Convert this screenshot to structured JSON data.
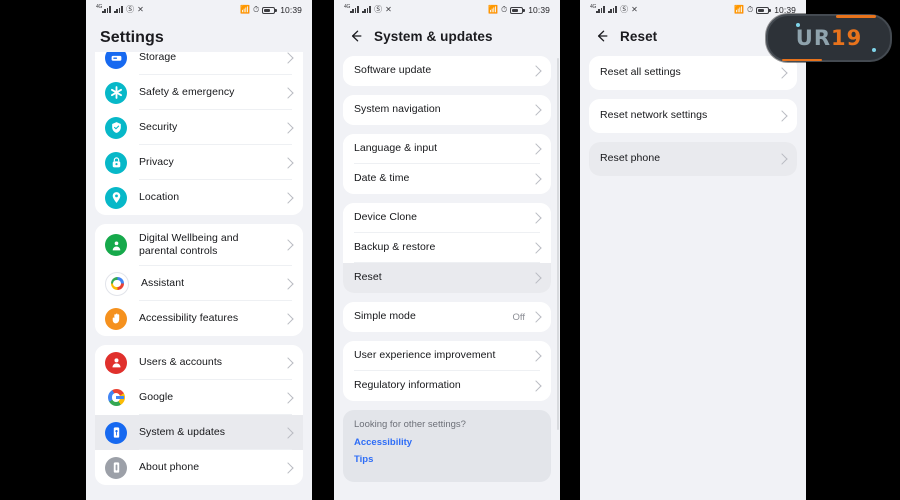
{
  "statusbar": {
    "time": "10:39",
    "left_icons": [
      "signal-4g-icon",
      "signal-bars-icon",
      "no-sim-icon",
      "silent-icon"
    ],
    "right_icons": [
      "vibrate-icon",
      "alarm-icon",
      "battery-icon"
    ],
    "signal_label": "4G"
  },
  "watermark": {
    "text_part_a": "UR",
    "text_part_b": "19"
  },
  "panels": {
    "settings": {
      "title": "Settings",
      "groups": [
        {
          "clipped_top": true,
          "rows": [
            {
              "label": "Storage",
              "icon": "storage-icon",
              "icon_class": "ic-storage",
              "selected": false
            },
            {
              "label": "Safety & emergency",
              "icon": "safety-emergency-icon",
              "icon_class": "ic-safety",
              "selected": false
            },
            {
              "label": "Security",
              "icon": "security-shield-icon",
              "icon_class": "ic-security",
              "selected": false
            },
            {
              "label": "Privacy",
              "icon": "privacy-lock-icon",
              "icon_class": "ic-privacy",
              "selected": false
            },
            {
              "label": "Location",
              "icon": "location-pin-icon",
              "icon_class": "ic-location",
              "selected": false
            }
          ]
        },
        {
          "clipped_top": false,
          "rows": [
            {
              "label": "Digital Wellbeing and parental controls",
              "icon": "digital-wellbeing-icon",
              "icon_class": "ic-wellbeing",
              "selected": false,
              "tall": true
            },
            {
              "label": "Assistant",
              "icon": "assistant-icon",
              "icon_class": "ic-assistant",
              "selected": false
            },
            {
              "label": "Accessibility features",
              "icon": "accessibility-hand-icon",
              "icon_class": "ic-access",
              "selected": false
            }
          ]
        },
        {
          "clipped_top": false,
          "rows": [
            {
              "label": "Users & accounts",
              "icon": "users-accounts-icon",
              "icon_class": "ic-users",
              "selected": false
            },
            {
              "label": "Google",
              "icon": "google-icon",
              "icon_class": "ic-google",
              "selected": false
            },
            {
              "label": "System & updates",
              "icon": "system-updates-icon",
              "icon_class": "ic-system",
              "selected": true
            },
            {
              "label": "About phone",
              "icon": "about-phone-icon",
              "icon_class": "ic-about",
              "selected": false
            }
          ]
        }
      ]
    },
    "system": {
      "title": "System & updates",
      "back_icon": "back-arrow-icon",
      "groups": [
        {
          "rows": [
            {
              "label": "Software update",
              "selected": false
            }
          ]
        },
        {
          "rows": [
            {
              "label": "System navigation",
              "selected": false
            }
          ]
        },
        {
          "rows": [
            {
              "label": "Language & input",
              "selected": false
            },
            {
              "label": "Date & time",
              "selected": false
            }
          ]
        },
        {
          "rows": [
            {
              "label": "Device Clone",
              "selected": false
            },
            {
              "label": "Backup & restore",
              "selected": false
            },
            {
              "label": "Reset",
              "selected": true
            }
          ]
        },
        {
          "rows": [
            {
              "label": "Simple mode",
              "value": "Off",
              "selected": false
            }
          ]
        },
        {
          "rows": [
            {
              "label": "User experience improvement",
              "selected": false
            },
            {
              "label": "Regulatory information",
              "selected": false
            }
          ]
        }
      ],
      "hint": {
        "title": "Looking for other settings?",
        "links": [
          "Accessibility",
          "Tips"
        ]
      }
    },
    "reset": {
      "title": "Reset",
      "back_icon": "back-arrow-icon",
      "groups": [
        {
          "rows": [
            {
              "label": "Reset all settings",
              "selected": false
            }
          ]
        },
        {
          "rows": [
            {
              "label": "Reset network settings",
              "selected": false
            }
          ]
        },
        {
          "rows": [
            {
              "label": "Reset phone",
              "selected": true
            }
          ]
        }
      ]
    }
  }
}
